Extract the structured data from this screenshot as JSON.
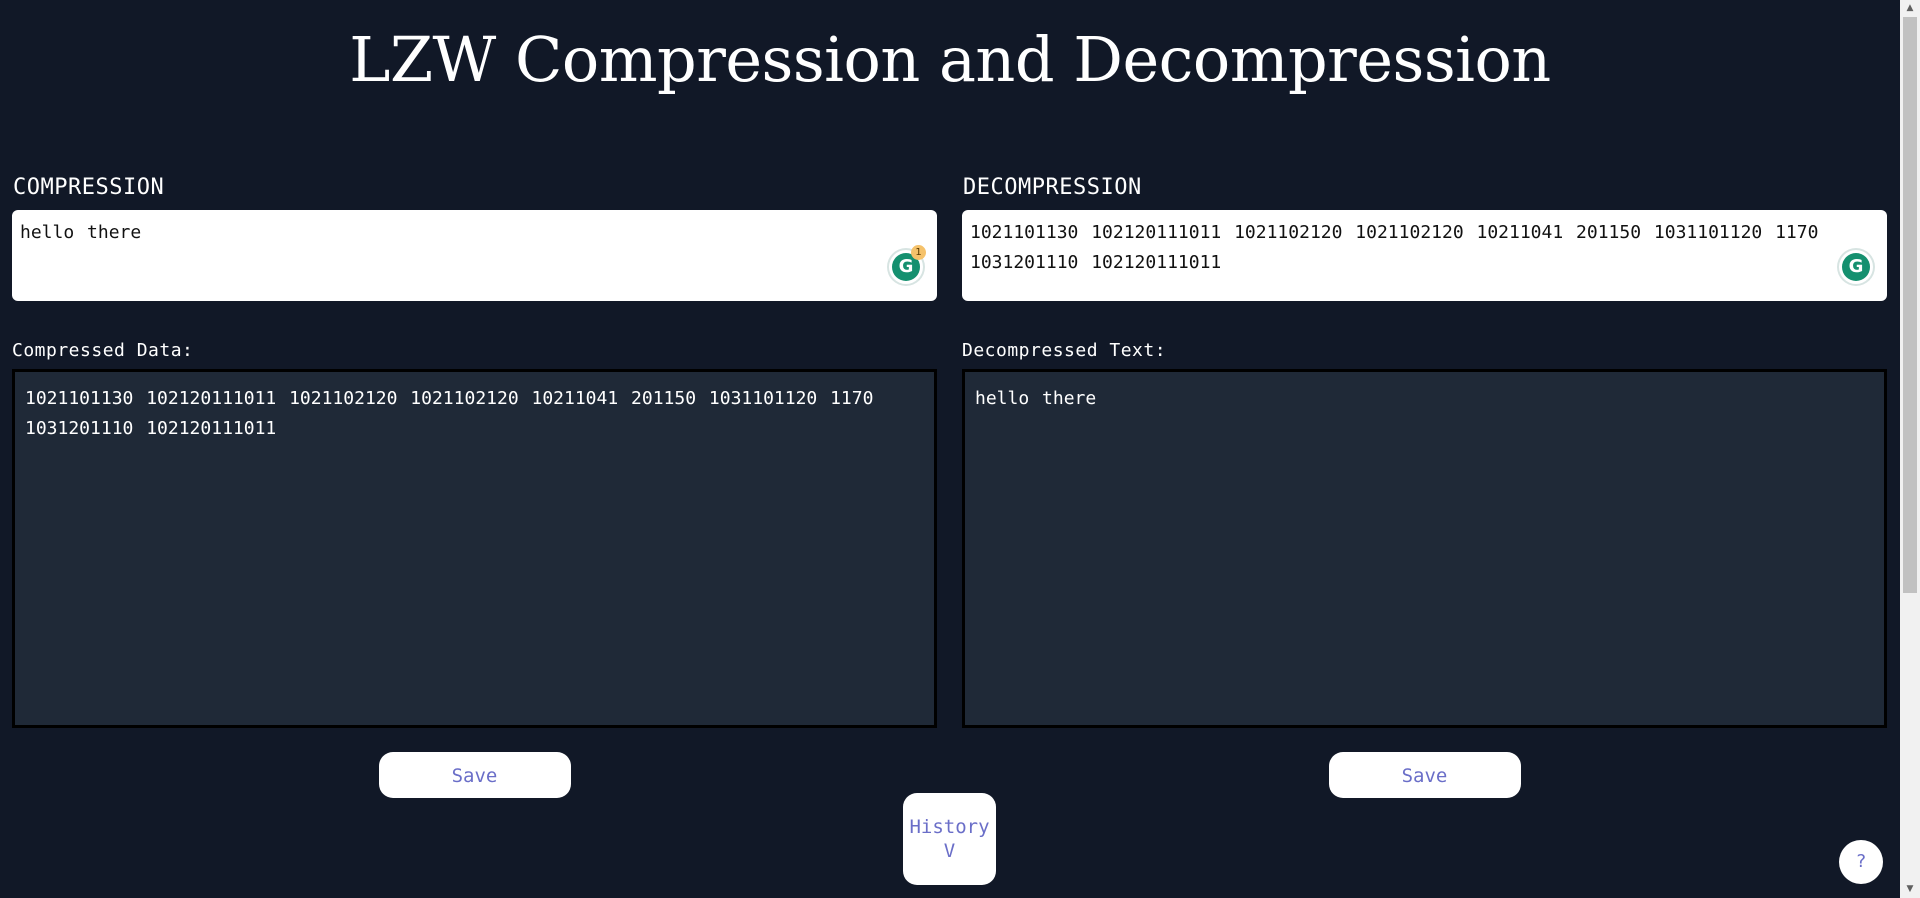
{
  "title": "LZW Compression and Decompression",
  "compression": {
    "label": "COMPRESSION",
    "input_value": "hello there",
    "grammarly_badge": "1",
    "output_label": "Compressed Data:",
    "output_value": "1021101130 102120111011 1021102120 1021102120 10211041 201150 1031101120 1170 1031201110 102120111011",
    "save_label": "Save"
  },
  "decompression": {
    "label": "DECOMPRESSION",
    "input_value": "1021101130 102120111011 1021102120 1021102120 10211041 201150 1031101120 1170 1031201110 102120111011",
    "output_label": "Decompressed Text:",
    "output_value": "hello there",
    "save_label": "Save"
  },
  "history": {
    "label": "History",
    "arrow": "V"
  },
  "help": {
    "label": "?"
  },
  "icons": {
    "grammarly": "grammarly-icon",
    "scroll_up": "scroll-up-arrow-icon",
    "scroll_down": "scroll-down-arrow-icon"
  },
  "colors": {
    "background": "#111827",
    "output_background": "#1f2937",
    "button_text": "#6a6ec8",
    "grammarly_green": "#15906f"
  }
}
